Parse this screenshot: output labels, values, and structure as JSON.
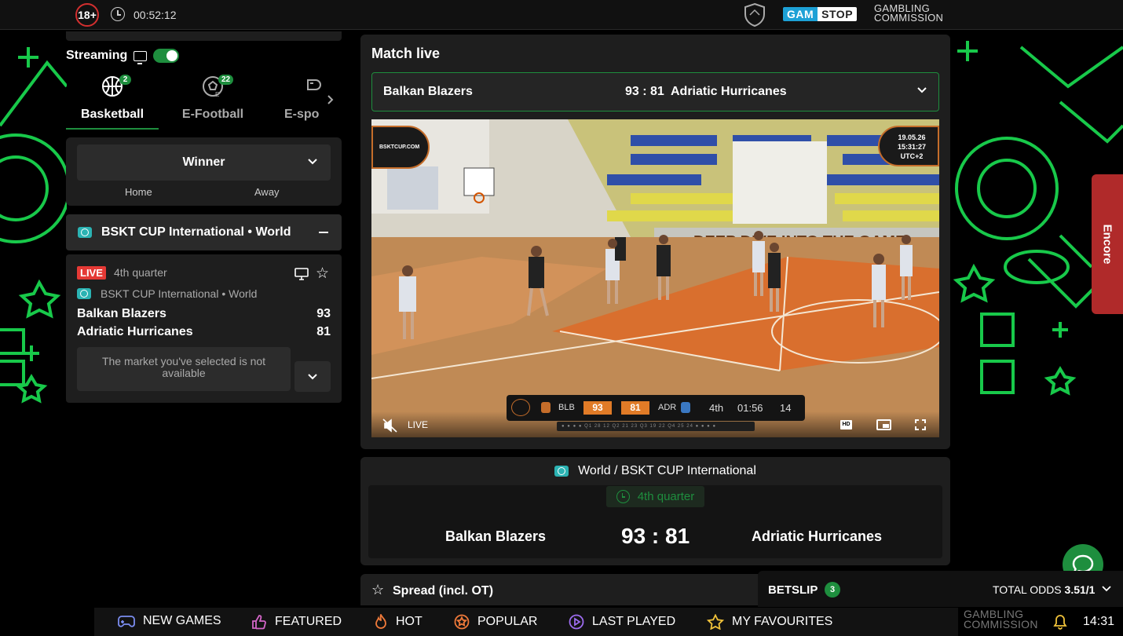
{
  "topbar": {
    "age_label": "18+",
    "session_time": "00:52:12",
    "gamstop_gam": "GAM",
    "gamstop_stop": "STOP",
    "gc_line1": "GAMBLING",
    "gc_line2": "COMMISSION"
  },
  "sidebar": {
    "streaming_label": "Streaming",
    "streaming_on": true,
    "sport_tabs": [
      {
        "label": "Basketball",
        "count": "2",
        "icon": "basketball-icon",
        "active": true
      },
      {
        "label": "E-Football",
        "count": "22",
        "icon": "esoccer-icon",
        "active": false
      },
      {
        "label": "E-spo",
        "count": "",
        "icon": "gamepad-icon",
        "active": false
      }
    ],
    "market": {
      "selected": "Winner",
      "col_home": "Home",
      "col_away": "Away"
    },
    "league": {
      "name": "BSKT CUP International • World"
    },
    "event": {
      "live_badge": "LIVE",
      "period": "4th quarter",
      "league": "BSKT CUP International • World",
      "home_team": "Balkan Blazers",
      "home_score": "93",
      "away_team": "Adriatic Hurricanes",
      "away_score": "81",
      "market_unavailable": "The market you've selected is not available"
    }
  },
  "match_live": {
    "title": "Match live",
    "selector": {
      "home": "Balkan Blazers",
      "score": "93 : 81",
      "away": "Adriatic Hurricanes"
    },
    "video": {
      "watermark_left": "BSKTCUP.COM",
      "watermark_date": "19.05.26",
      "watermark_time": "15:31:27",
      "watermark_tz": "UTC+2",
      "banner_text": "DEEP DIVE INTO THE GAME",
      "scorebug": {
        "home_abbr": "BLB",
        "home_score": "93",
        "away_score": "81",
        "away_abbr": "ADR",
        "period": "4th",
        "clock": "01:56",
        "shot_clock": "14"
      },
      "quarter_strip": "● ● ● ●  Q1 28 12   Q2 21 23   Q3 19 22   Q4 25 24  ● ● ● ●",
      "live_label": "LIVE",
      "hd_label": "HD"
    }
  },
  "scoreboard": {
    "league": "World / BSKT CUP International",
    "period": "4th quarter",
    "home": "Balkan Blazers",
    "score": "93 : 81",
    "away": "Adriatic Hurricanes"
  },
  "spread": {
    "title": "Spread (incl. OT)"
  },
  "encore": {
    "label": "Encore"
  },
  "betslip": {
    "label": "BETSLIP",
    "count": "3",
    "total_label": "TOTAL ODDS",
    "total_value": "3.51/1"
  },
  "bottom_nav": {
    "items": [
      {
        "label": "NEW GAMES",
        "icon": "gamepad-icon"
      },
      {
        "label": "FEATURED",
        "icon": "thumbs-up-icon"
      },
      {
        "label": "HOT",
        "icon": "flame-icon"
      },
      {
        "label": "POPULAR",
        "icon": "popular-star-icon"
      },
      {
        "label": "LAST PLAYED",
        "icon": "play-icon"
      },
      {
        "label": "MY FAVOURITES",
        "icon": "star-icon"
      }
    ],
    "gc_line1": "GAMBLING",
    "gc_line2": "COMMISSION",
    "clock": "14:31"
  },
  "colors": {
    "accent_green": "#1e8e3e",
    "live_red": "#e53935",
    "encore_red": "#b02a2a",
    "scorebug_orange": "#e07b27",
    "neon_green": "#18c94a"
  }
}
